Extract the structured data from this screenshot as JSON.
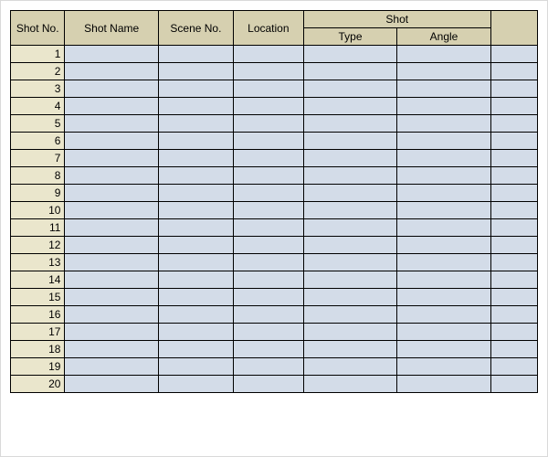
{
  "headers": {
    "shot_no": "Shot No.",
    "shot_name": "Shot Name",
    "scene_no": "Scene No.",
    "location": "Location",
    "shot_group": "Shot",
    "shot_type": "Type",
    "shot_angle": "Angle",
    "extra": ""
  },
  "rows": [
    {
      "no": "1",
      "name": "",
      "scene": "",
      "location": "",
      "type": "",
      "angle": "",
      "extra": ""
    },
    {
      "no": "2",
      "name": "",
      "scene": "",
      "location": "",
      "type": "",
      "angle": "",
      "extra": ""
    },
    {
      "no": "3",
      "name": "",
      "scene": "",
      "location": "",
      "type": "",
      "angle": "",
      "extra": ""
    },
    {
      "no": "4",
      "name": "",
      "scene": "",
      "location": "",
      "type": "",
      "angle": "",
      "extra": ""
    },
    {
      "no": "5",
      "name": "",
      "scene": "",
      "location": "",
      "type": "",
      "angle": "",
      "extra": ""
    },
    {
      "no": "6",
      "name": "",
      "scene": "",
      "location": "",
      "type": "",
      "angle": "",
      "extra": ""
    },
    {
      "no": "7",
      "name": "",
      "scene": "",
      "location": "",
      "type": "",
      "angle": "",
      "extra": ""
    },
    {
      "no": "8",
      "name": "",
      "scene": "",
      "location": "",
      "type": "",
      "angle": "",
      "extra": ""
    },
    {
      "no": "9",
      "name": "",
      "scene": "",
      "location": "",
      "type": "",
      "angle": "",
      "extra": ""
    },
    {
      "no": "10",
      "name": "",
      "scene": "",
      "location": "",
      "type": "",
      "angle": "",
      "extra": ""
    },
    {
      "no": "11",
      "name": "",
      "scene": "",
      "location": "",
      "type": "",
      "angle": "",
      "extra": ""
    },
    {
      "no": "12",
      "name": "",
      "scene": "",
      "location": "",
      "type": "",
      "angle": "",
      "extra": ""
    },
    {
      "no": "13",
      "name": "",
      "scene": "",
      "location": "",
      "type": "",
      "angle": "",
      "extra": ""
    },
    {
      "no": "14",
      "name": "",
      "scene": "",
      "location": "",
      "type": "",
      "angle": "",
      "extra": ""
    },
    {
      "no": "15",
      "name": "",
      "scene": "",
      "location": "",
      "type": "",
      "angle": "",
      "extra": ""
    },
    {
      "no": "16",
      "name": "",
      "scene": "",
      "location": "",
      "type": "",
      "angle": "",
      "extra": ""
    },
    {
      "no": "17",
      "name": "",
      "scene": "",
      "location": "",
      "type": "",
      "angle": "",
      "extra": ""
    },
    {
      "no": "18",
      "name": "",
      "scene": "",
      "location": "",
      "type": "",
      "angle": "",
      "extra": ""
    },
    {
      "no": "19",
      "name": "",
      "scene": "",
      "location": "",
      "type": "",
      "angle": "",
      "extra": ""
    },
    {
      "no": "20",
      "name": "",
      "scene": "",
      "location": "",
      "type": "",
      "angle": "",
      "extra": ""
    }
  ]
}
